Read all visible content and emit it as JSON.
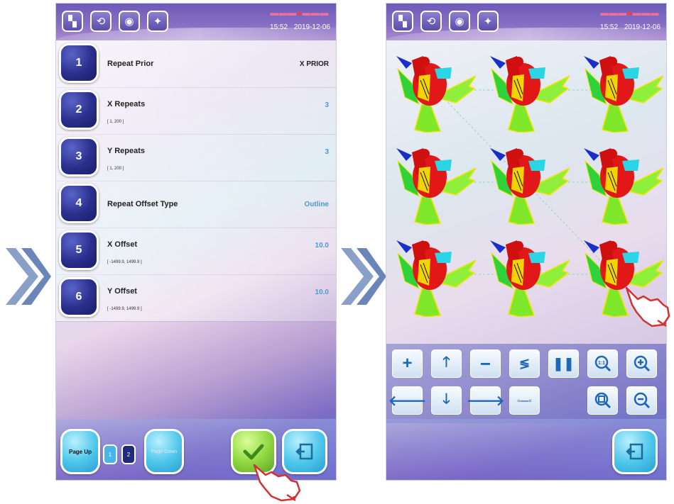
{
  "left_screen": {
    "time": "15:52",
    "date": "2019-12-06",
    "rows": [
      {
        "number": "1",
        "label": "Repeat Prior",
        "range": "",
        "value": "X PRIOR"
      },
      {
        "number": "2",
        "label": "X Repeats",
        "range": "[ 1, 200 ]",
        "value": "3"
      },
      {
        "number": "3",
        "label": "Y Repeats",
        "range": "[ 1, 200 ]",
        "value": "3"
      },
      {
        "number": "4",
        "label": "Repeat Offset Type",
        "range": "",
        "value": "Outline"
      },
      {
        "number": "5",
        "label": "X Offset",
        "range": "[ -1499.9, 1499.9 ]",
        "value": "10.0"
      },
      {
        "number": "6",
        "label": "Y Offset",
        "range": "[ -1499.9, 1499.9 ]",
        "value": "10.0"
      }
    ],
    "page_up_label": "Page Up",
    "page_down_label": "Page Down",
    "pages": [
      "1",
      "2"
    ],
    "current_page": "2"
  },
  "right_screen": {
    "time": "15:52",
    "date": "2019-12-06",
    "pattern_grid": {
      "columns": 3,
      "rows": 3
    }
  },
  "icons": {
    "topbar": [
      "layers-icon",
      "repeat-icon",
      "rotate-icon",
      "lightbulb-icon"
    ],
    "controls_row1": [
      "plus-icon",
      "arrow-up-icon",
      "minus-icon",
      "stitch-icon",
      "pause-icon",
      "zoom-1-1-icon",
      "zoom-in-icon"
    ],
    "controls_row2": [
      "arrow-left-icon",
      "arrow-down-icon",
      "arrow-right-icon",
      "link-icon",
      "zoom-fit-icon",
      "zoom-out-icon"
    ]
  },
  "colors": {
    "number_button": "#2a2f8c",
    "confirm_button": "#8ed63e",
    "cyan_button": "#4cc6ea",
    "value_blue": "#4a9bd0",
    "control_icon": "#1e66b8"
  }
}
